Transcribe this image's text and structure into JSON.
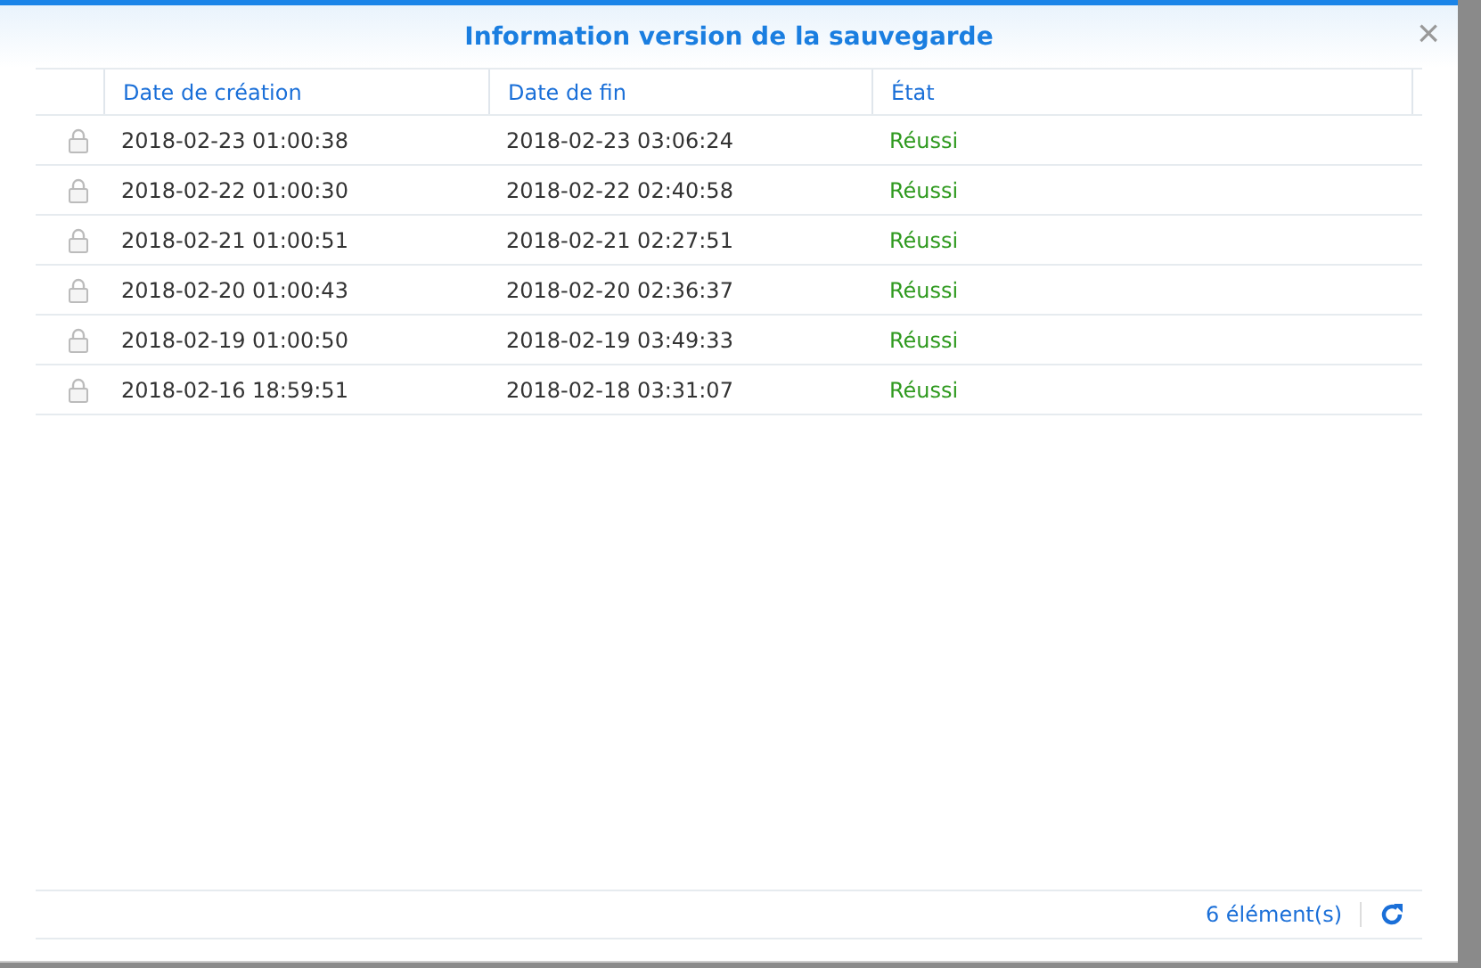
{
  "dialog": {
    "title": "Information version de la sauvegarde",
    "close": "×"
  },
  "table": {
    "columns": [
      "Date de création",
      "Date de fin",
      "État"
    ],
    "rows": [
      {
        "created": "2018-02-23 01:00:38",
        "ended": "2018-02-23 03:06:24",
        "status": "Réussi"
      },
      {
        "created": "2018-02-22 01:00:30",
        "ended": "2018-02-22 02:40:58",
        "status": "Réussi"
      },
      {
        "created": "2018-02-21 01:00:51",
        "ended": "2018-02-21 02:27:51",
        "status": "Réussi"
      },
      {
        "created": "2018-02-20 01:00:43",
        "ended": "2018-02-20 02:36:37",
        "status": "Réussi"
      },
      {
        "created": "2018-02-19 01:00:50",
        "ended": "2018-02-19 03:49:33",
        "status": "Réussi"
      },
      {
        "created": "2018-02-16 18:59:51",
        "ended": "2018-02-18 03:31:07",
        "status": "Réussi"
      }
    ]
  },
  "footer": {
    "count": "6 élément(s)"
  }
}
